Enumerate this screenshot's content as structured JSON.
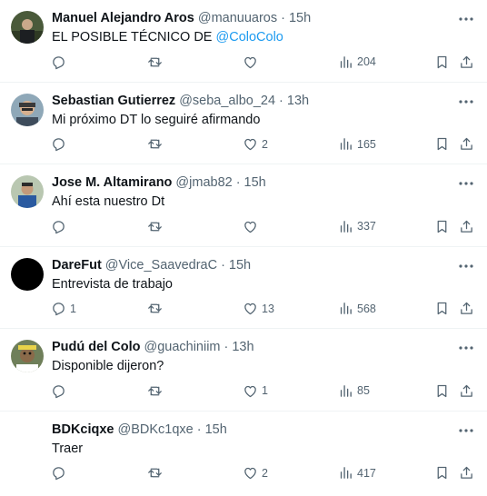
{
  "tweets": [
    {
      "name": "Manuel Alejandro Aros",
      "handle": "@manuuaros",
      "sep": "·",
      "time": "15h",
      "text_before": "EL POSIBLE TÉCNICO DE ",
      "mention": "@ColoColo",
      "replies": "",
      "reposts": "",
      "likes": "",
      "views": "204"
    },
    {
      "name": "Sebastian Gutierrez",
      "handle": "@seba_albo_24",
      "sep": "·",
      "time": "13h",
      "text_before": "Mi próximo DT lo seguiré afirmando",
      "mention": "",
      "replies": "",
      "reposts": "",
      "likes": "2",
      "views": "165"
    },
    {
      "name": "Jose M. Altamirano",
      "handle": "@jmab82",
      "sep": "·",
      "time": "15h",
      "text_before": "Ahí esta nuestro Dt",
      "mention": "",
      "replies": "",
      "reposts": "",
      "likes": "",
      "views": "337"
    },
    {
      "name": "DareFut",
      "handle": "@Vice_SaavedraC",
      "sep": "·",
      "time": "15h",
      "text_before": "Entrevista de trabajo",
      "mention": "",
      "replies": "1",
      "reposts": "",
      "likes": "13",
      "views": "568"
    },
    {
      "name": "Pudú del Colo",
      "handle": "@guachiniim",
      "sep": "·",
      "time": "13h",
      "text_before": "Disponible dijeron?",
      "mention": "",
      "replies": "",
      "reposts": "",
      "likes": "1",
      "views": "85"
    },
    {
      "name": "BDKciqxe",
      "handle": "@BDKc1qxe",
      "sep": "·",
      "time": "15h",
      "text_before": "Traer",
      "mention": "",
      "replies": "",
      "reposts": "",
      "likes": "2",
      "views": "417"
    }
  ],
  "colors": {
    "text": "#0f1419",
    "secondary": "#536471",
    "link": "#1d9bf0",
    "divider": "#eff3f4"
  },
  "icons": [
    "reply-icon",
    "repost-icon",
    "like-icon",
    "views-icon",
    "bookmark-icon",
    "share-icon",
    "more-icon"
  ]
}
